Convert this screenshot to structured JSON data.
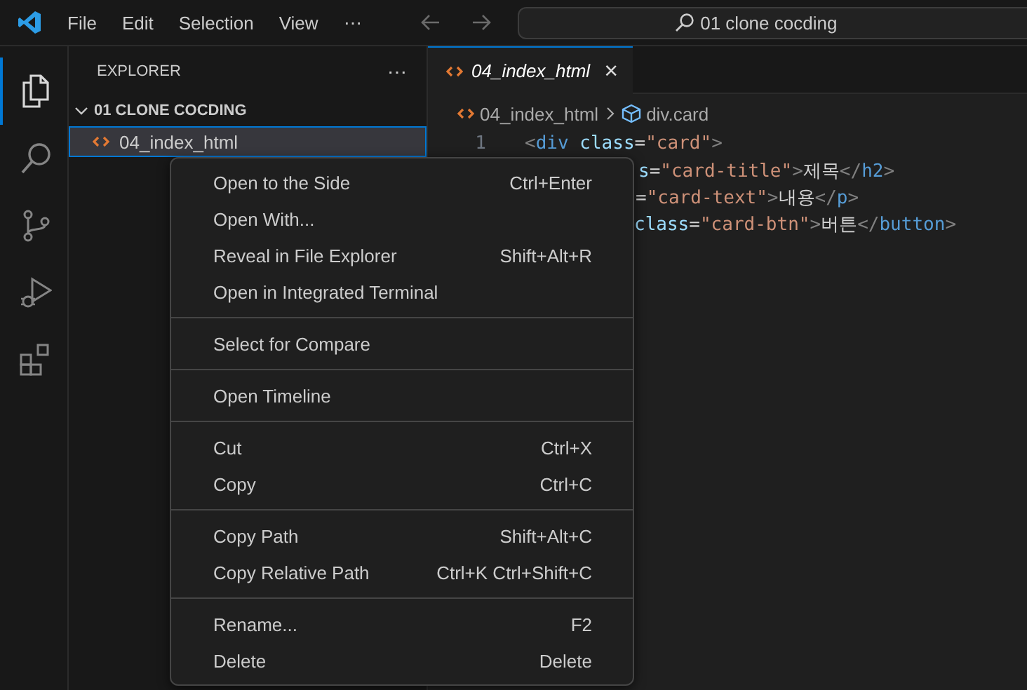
{
  "title_bar": {
    "menus": [
      "File",
      "Edit",
      "Selection",
      "View",
      "⋯"
    ],
    "search": "01 clone cocding"
  },
  "activity_bar": [
    {
      "kind": "files",
      "selected": true
    },
    {
      "kind": "search",
      "selected": false
    },
    {
      "kind": "source",
      "selected": false
    },
    {
      "kind": "debug",
      "selected": false
    },
    {
      "kind": "extensions",
      "selected": false
    }
  ],
  "sidebar": {
    "title": "EXPLORER",
    "more": "⋯",
    "folder": {
      "name": "01 CLONE COCDING",
      "expanded": true,
      "children": [
        {
          "name": "04_index_html",
          "selected": true
        }
      ]
    }
  },
  "tabs": [
    {
      "label": "04_index_html",
      "selected": true,
      "preview": true,
      "close": "×"
    }
  ],
  "breadcrumb": [
    "04_index_html",
    "div.card"
  ],
  "code": [
    {
      "number": "1",
      "tokens": [
        {
          "kind": "punct",
          "text": "<"
        },
        {
          "kind": "tag",
          "text": "div"
        },
        {
          "kind": "attr",
          "text": " class"
        },
        {
          "kind": "text",
          "text": "="
        },
        {
          "kind": "string",
          "text": "\"card\""
        },
        {
          "kind": "punct",
          "text": ">"
        }
      ]
    },
    {
      "tokens": [
        {
          "kind": "attr",
          "text": "s"
        },
        {
          "kind": "text",
          "text": "="
        },
        {
          "kind": "string",
          "text": "\"card-title\""
        },
        {
          "kind": "punct",
          "text": ">"
        },
        {
          "kind": "text",
          "text": "제목"
        },
        {
          "kind": "punct",
          "text": "</"
        },
        {
          "kind": "tag",
          "text": "h2"
        },
        {
          "kind": "punct",
          "text": ">"
        }
      ]
    },
    {
      "tokens": [
        {
          "kind": "text",
          "text": "="
        },
        {
          "kind": "string",
          "text": "\"card-text\""
        },
        {
          "kind": "punct",
          "text": ">"
        },
        {
          "kind": "text",
          "text": "내용"
        },
        {
          "kind": "punct",
          "text": "</"
        },
        {
          "kind": "tag",
          "text": "p"
        },
        {
          "kind": "punct",
          "text": ">"
        }
      ]
    },
    {
      "tokens": [
        {
          "kind": "attr",
          "text": "class"
        },
        {
          "kind": "text",
          "text": "="
        },
        {
          "kind": "string",
          "text": "\"card-btn\""
        },
        {
          "kind": "punct",
          "text": ">"
        },
        {
          "kind": "text",
          "text": "버튼"
        },
        {
          "kind": "punct",
          "text": "</"
        },
        {
          "kind": "tag",
          "text": "button"
        },
        {
          "kind": "punct",
          "text": ">"
        }
      ]
    }
  ],
  "context_menu": [
    [
      {
        "label": "Open to the Side",
        "shortcut": "Ctrl+Enter"
      },
      {
        "label": "Open With..."
      },
      {
        "label": "Reveal in File Explorer",
        "shortcut": "Shift+Alt+R"
      },
      {
        "label": "Open in Integrated Terminal"
      }
    ],
    [
      {
        "label": "Select for Compare"
      }
    ],
    [
      {
        "label": "Open Timeline"
      }
    ],
    [
      {
        "label": "Cut",
        "shortcut": "Ctrl+X"
      },
      {
        "label": "Copy",
        "shortcut": "Ctrl+C"
      }
    ],
    [
      {
        "label": "Copy Path",
        "shortcut": "Shift+Alt+C"
      },
      {
        "label": "Copy Relative Path",
        "shortcut": "Ctrl+K Ctrl+Shift+C"
      }
    ],
    [
      {
        "label": "Rename...",
        "shortcut": "F2"
      },
      {
        "label": "Delete",
        "shortcut": "Delete"
      }
    ]
  ]
}
